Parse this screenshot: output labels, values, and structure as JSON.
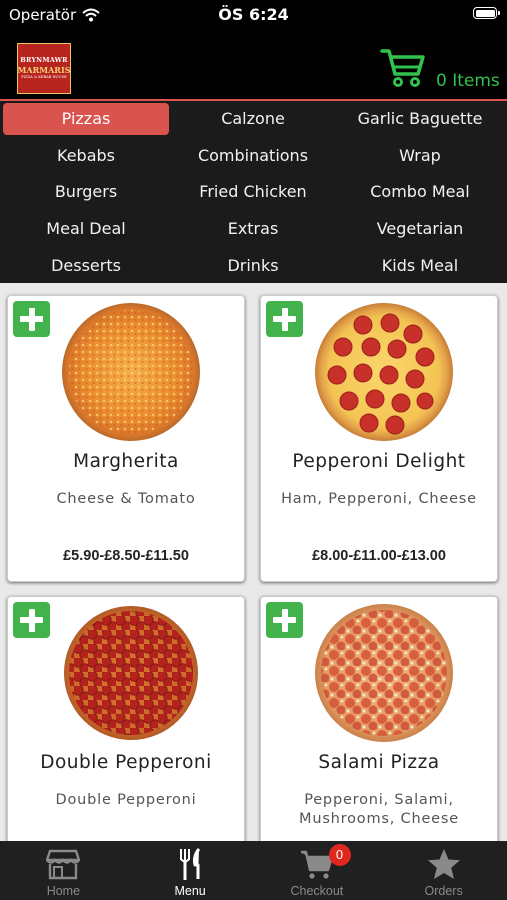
{
  "status_bar": {
    "carrier": "Operatör",
    "time": "ÖS 6:24"
  },
  "header": {
    "logo": {
      "line1": "BRYNMAWR",
      "line2": "MARMARIS",
      "line3": "PIZZA & KEBAB HOUSE"
    },
    "cart_label": "0 Items",
    "accent_color": "#33c24d"
  },
  "categories": {
    "active": "Pizzas",
    "active_color": "#d9534f",
    "items": [
      "Pizzas",
      "Calzone",
      "Garlic Baguette",
      "Kebabs",
      "Combinations",
      "Wrap",
      "Burgers",
      "Fried Chicken",
      "Combo Meal",
      "Meal Deal",
      "Extras",
      "Vegetarian",
      "Desserts",
      "Drinks",
      "Kids Meal"
    ]
  },
  "products": [
    {
      "name": "Margherita",
      "description": "Cheese & Tomato",
      "price": "£5.90-£8.50-£11.50",
      "image": "margherita-pizza"
    },
    {
      "name": "Pepperoni Delight",
      "description": "Ham, Pepperoni, Cheese",
      "price": "£8.00-£11.00-£13.00",
      "image": "pepperoni-pizza"
    },
    {
      "name": "Double Pepperoni",
      "description": "Double Pepperoni",
      "price": "",
      "image": "double-pepperoni-pizza"
    },
    {
      "name": "Salami Pizza",
      "description": "Pepperoni, Salami, Mushrooms, Cheese",
      "price": "",
      "image": "salami-pizza"
    }
  ],
  "tab_bar": {
    "tabs": [
      {
        "label": "Home",
        "icon": "store-icon"
      },
      {
        "label": "Menu",
        "icon": "fork-knife-icon"
      },
      {
        "label": "Checkout",
        "icon": "cart-icon",
        "badge": "0"
      },
      {
        "label": "Orders",
        "icon": "star-icon"
      }
    ],
    "active": "Menu"
  }
}
